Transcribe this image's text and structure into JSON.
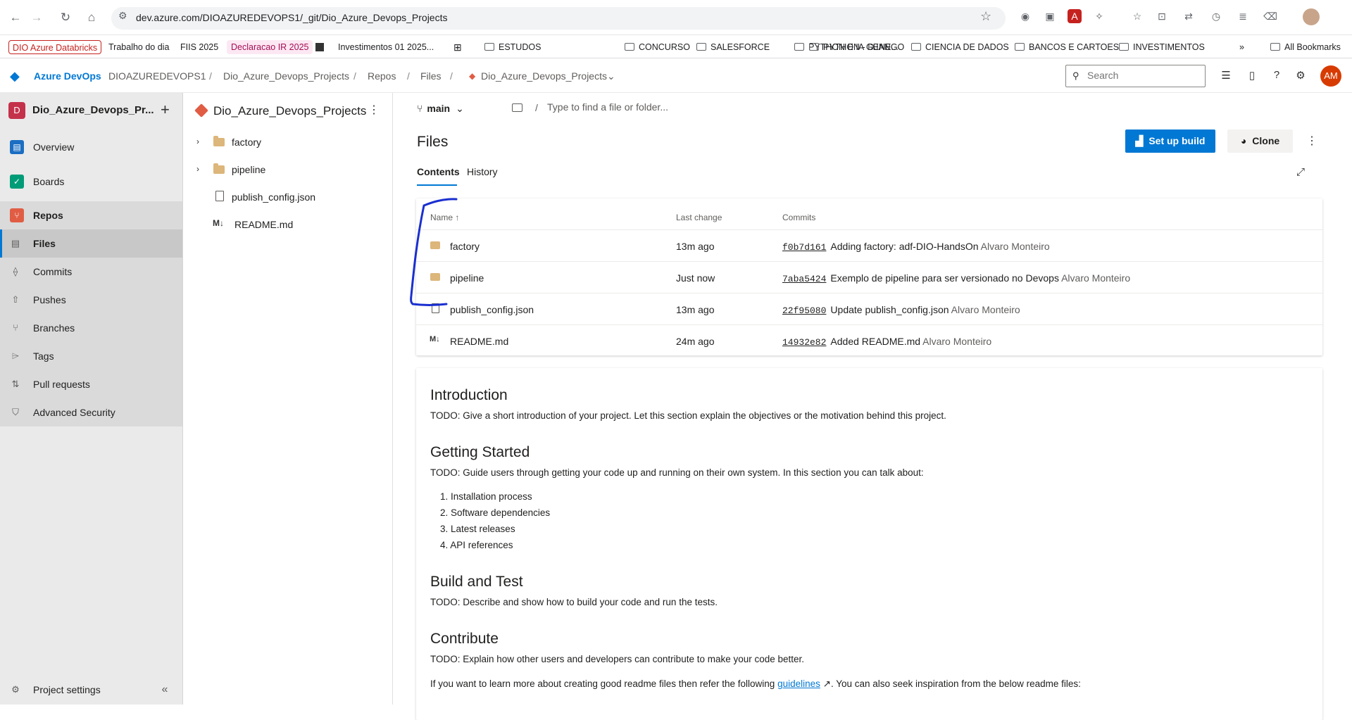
{
  "browser": {
    "url": "dev.azure.com/DIOAZUREDEVOPS1/_git/Dio_Azure_Devops_Projects",
    "bookmarks": [
      {
        "label": "DIO Azure Databricks"
      },
      {
        "label": "Trabalho do dia"
      },
      {
        "label": "FIIS 2025"
      },
      {
        "label": "Declaracao IR 2025"
      },
      {
        "label": "Investimentos 01 2025..."
      },
      {
        "label": "ESTUDOS"
      },
      {
        "label": "CONCURSO"
      },
      {
        "label": "SALESFORCE"
      },
      {
        "label": "PYTHON E IA GENE..."
      },
      {
        "label": "PYTHON - DJANGO"
      },
      {
        "label": "CIENCIA DE DADOS"
      },
      {
        "label": "BANCOS E CARTOES"
      },
      {
        "label": "INVESTIMENTOS"
      },
      {
        "label": "All Bookmarks"
      }
    ]
  },
  "header": {
    "brand": "Azure DevOps",
    "breadcrumbs": [
      "DIOAZUREDEVOPS1",
      "Dio_Azure_Devops_Projects",
      "Repos",
      "Files",
      "Dio_Azure_Devops_Projects"
    ],
    "search_placeholder": "Search",
    "avatar_initials": "AM"
  },
  "sidebar": {
    "project_initial": "D",
    "project_name": "Dio_Azure_Devops_Pr...",
    "items": [
      {
        "label": "Overview",
        "icon": "overview-icon"
      },
      {
        "label": "Boards",
        "icon": "boards-icon"
      },
      {
        "label": "Repos",
        "icon": "repos-icon"
      }
    ],
    "sub_items": [
      {
        "label": "Files",
        "icon": "files-icon"
      },
      {
        "label": "Commits",
        "icon": "commits-icon"
      },
      {
        "label": "Pushes",
        "icon": "pushes-icon"
      },
      {
        "label": "Branches",
        "icon": "branches-icon"
      },
      {
        "label": "Tags",
        "icon": "tags-icon"
      },
      {
        "label": "Pull requests",
        "icon": "pull-requests-icon"
      },
      {
        "label": "Advanced Security",
        "icon": "shield-icon"
      }
    ],
    "settings_label": "Project settings"
  },
  "tree": {
    "repo_name": "Dio_Azure_Devops_Projects",
    "items": [
      {
        "label": "factory",
        "type": "folder"
      },
      {
        "label": "pipeline",
        "type": "folder"
      },
      {
        "label": "publish_config.json",
        "type": "file"
      },
      {
        "label": "README.md",
        "type": "markdown"
      }
    ]
  },
  "main": {
    "branch": "main",
    "path_placeholder": "Type to find a file or folder...",
    "title": "Files",
    "setup_build_label": "Set up build",
    "clone_label": "Clone",
    "tabs": [
      "Contents",
      "History"
    ],
    "columns": [
      "Name ↑",
      "Last change",
      "Commits"
    ],
    "rows": [
      {
        "name": "factory",
        "type": "folder",
        "last_change": "13m ago",
        "sha": "f0b7d161",
        "message": "Adding factory: adf-DIO-HandsOn",
        "author": "Alvaro Monteiro"
      },
      {
        "name": "pipeline",
        "type": "folder",
        "last_change": "Just now",
        "sha": "7aba5424",
        "message": "Exemplo de pipeline para ser versionado no Devops",
        "author": "Alvaro Monteiro"
      },
      {
        "name": "publish_config.json",
        "type": "file",
        "last_change": "13m ago",
        "sha": "22f95080",
        "message": "Update publish_config.json",
        "author": "Alvaro Monteiro"
      },
      {
        "name": "README.md",
        "type": "markdown",
        "last_change": "24m ago",
        "sha": "14932e82",
        "message": "Added README.md",
        "author": "Alvaro Monteiro"
      }
    ]
  },
  "readme": {
    "h_intro": "Introduction",
    "p_intro": "TODO: Give a short introduction of your project. Let this section explain the objectives or the motivation behind this project.",
    "h_start": "Getting Started",
    "p_start": "TODO: Guide users through getting your code up and running on their own system. In this section you can talk about:",
    "list": [
      "Installation process",
      "Software dependencies",
      "Latest releases",
      "API references"
    ],
    "h_build": "Build and Test",
    "p_build": "TODO: Describe and show how to build your code and run the tests.",
    "h_contrib": "Contribute",
    "p_contrib": "TODO: Explain how other users and developers can contribute to make your code better.",
    "p_more_pre": "If you want to learn more about creating good readme files then refer the following",
    "p_more_link": "guidelines",
    "p_more_post": ". You can also seek inspiration from the below readme files:"
  },
  "colors": {
    "accent": "#0078d4",
    "annotation": "#1a2fd0",
    "project_badge": "#c4314b"
  }
}
